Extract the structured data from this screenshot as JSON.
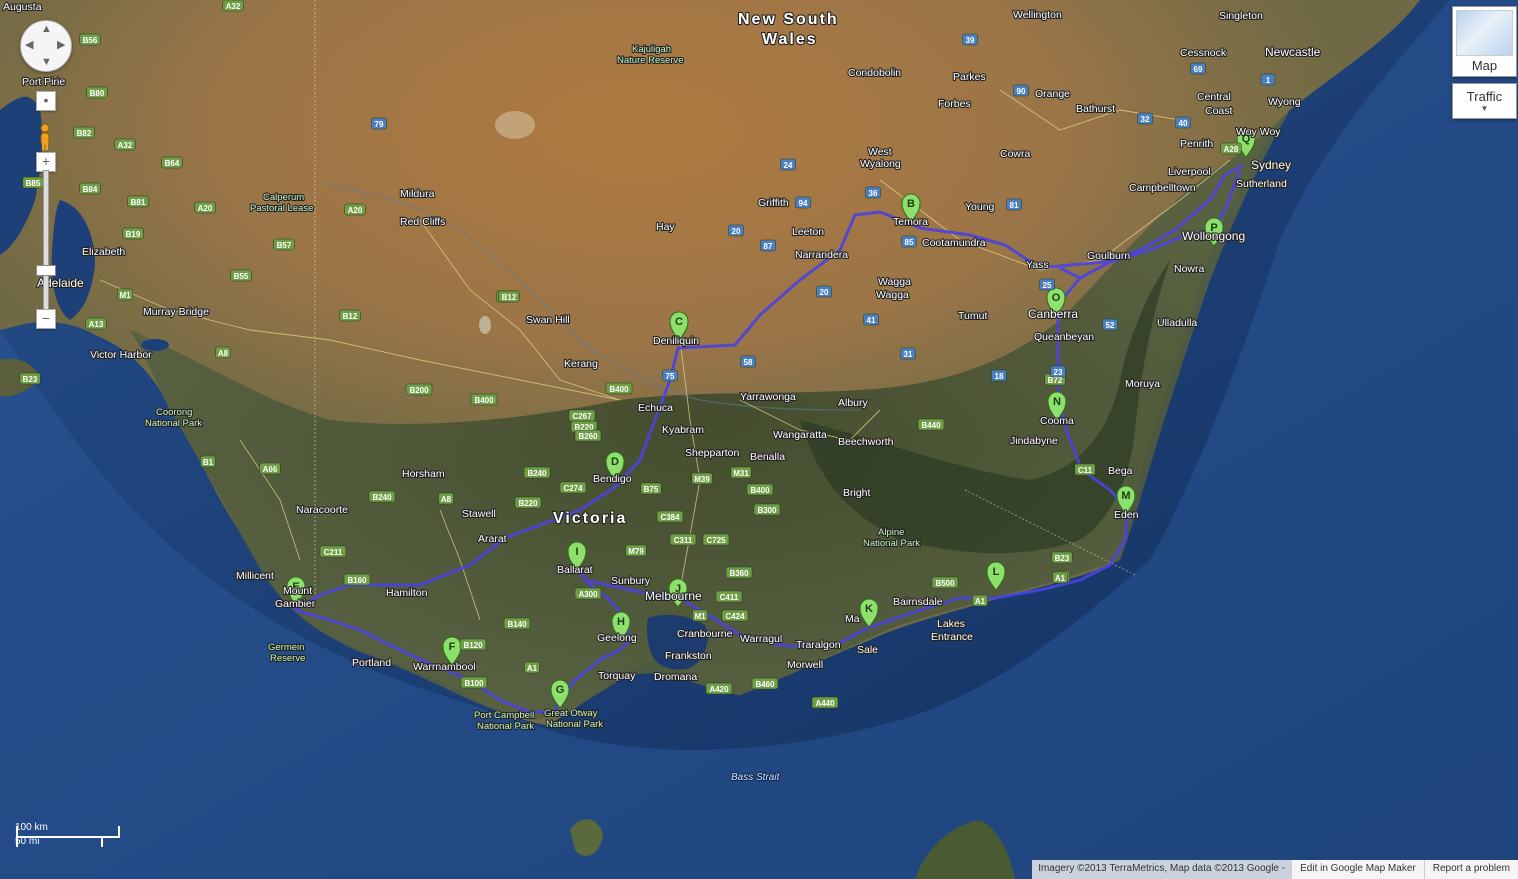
{
  "map_type": {
    "map_label": "Map",
    "traffic_label": "Traffic"
  },
  "colors": {
    "route": "#4b43e0",
    "marker": "#8edf6c",
    "marker_stroke": "#2f6e1e"
  },
  "regions": {
    "nsw": "New South Wales",
    "vic": "Victoria"
  },
  "route_markers": [
    "B",
    "C",
    "D",
    "E",
    "F",
    "G",
    "H",
    "I",
    "J",
    "K",
    "L",
    "M",
    "N",
    "O",
    "P",
    "Q"
  ],
  "places": {
    "augusta": "Augusta",
    "port_pirie": "Port Pirie",
    "adelaide": "Adelaide",
    "elizabeth": "Elizabeth",
    "murray_bridge": "Murray Bridge",
    "victor_harbor": "Victor Harbor",
    "mildura": "Mildura",
    "red_cliffs": "Red Cliffs",
    "swan_hill": "Swan Hill",
    "kerang": "Kerang",
    "echuca": "Echuca",
    "kyabram": "Kyabram",
    "shepparton": "Shepparton",
    "benalla": "Benalla",
    "wangaratta": "Wangaratta",
    "beechworth": "Beechworth",
    "albury": "Albury",
    "yarrawonga": "Yarrawonga",
    "deniliquin": "Deniliquin",
    "hay": "Hay",
    "griffith": "Griffith",
    "leeton": "Leeton",
    "narrandera": "Narrandera",
    "wagga1": "Wagga",
    "wagga2": "Wagga",
    "temora": "Temora",
    "cootamundra": "Cootamundra",
    "young": "Young",
    "west_wyalong1": "West",
    "west_wyalong2": "Wyalong",
    "condobolin": "Condobolin",
    "parkes": "Parkes",
    "forbes": "Forbes",
    "orange": "Orange",
    "bathurst": "Bathurst",
    "cowra": "Cowra",
    "wellington": "Wellington",
    "singleton": "Singleton",
    "cessnock": "Cessnock",
    "newcastle": "Newcastle",
    "wyong": "Wyong",
    "central_coast1": "Central",
    "central_coast2": "Coast",
    "woy_woy": "Woy Woy",
    "penrith": "Penrith",
    "liverpool": "Liverpool",
    "campbelltown": "Campbelltown",
    "sydney": "Sydney",
    "sutherland": "Sutherland",
    "wollongong": "Wollongong",
    "nowra": "Nowra",
    "goulburn": "Goulburn",
    "yass": "Yass",
    "canberra": "Canberra",
    "queanbeyan": "Queanbeyan",
    "tumut": "Tumut",
    "ulladulla": "Ulladulla",
    "moruya": "Moruya",
    "cooma": "Cooma",
    "jindabyne": "Jindabyne",
    "bega": "Bega",
    "eden": "Eden",
    "bendigo": "Bendigo",
    "horsham": "Horsham",
    "stawell": "Stawell",
    "ararat": "Ararat",
    "ballarat": "Ballarat",
    "sunbury": "Sunbury",
    "melbourne": "Melbourne",
    "geelong": "Geelong",
    "torquay": "Torquay",
    "frankston": "Frankston",
    "cranbourne": "Cranbourne",
    "dromana": "Dromana",
    "warragul": "Warragul",
    "traralgon": "Traralgon",
    "morwell": "Morwell",
    "sale": "Sale",
    "maffra": "Ma",
    "bairnsdale": "Bairnsdale",
    "lakes_entrance1": "Lakes",
    "lakes_entrance2": "Entrance",
    "bright": "Bright",
    "hamilton": "Hamilton",
    "portland": "Portland",
    "warrnambool": "Warrnambool",
    "mount_gambier1": "Mount",
    "mount_gambier2": "Gambier",
    "millicent": "Millicent",
    "naracoorte": "Naracoorte",
    "vic_park_label": "Victoria"
  },
  "parks": {
    "kajuligah1": "Kajuligah",
    "kajuligah2": "Nature Reserve",
    "calperum1": "Calperum",
    "calperum2": "Pastoral Lease",
    "coorong1": "Coorong",
    "coorong2": "National Park",
    "alpine1": "Alpine",
    "alpine2": "National Park",
    "germein1": "Germein",
    "germein2": "Reserve",
    "port_campbell1": "Port Campbell",
    "port_campbell2": "National Park",
    "otway1": "Great Otway",
    "otway2": "National Park"
  },
  "water": {
    "bass_strait": "Bass Strait"
  },
  "shields": [
    "A32",
    "B56",
    "B80",
    "B82",
    "A32",
    "B64",
    "B85",
    "B84",
    "B81",
    "A20",
    "B19",
    "A20",
    "B57",
    "B55",
    "M1",
    "A13",
    "B23",
    "B12",
    "A8",
    "B1",
    "A66",
    "B12",
    "B240",
    "A8",
    "C211",
    "B160",
    "B200",
    "B400",
    "B220",
    "B260",
    "C267",
    "B240",
    "B220",
    "C274",
    "B75",
    "M39",
    "M31",
    "C384",
    "B300",
    "C311",
    "C725",
    "M79",
    "B360",
    "A300",
    "C411",
    "C424",
    "M1",
    "B140",
    "B120",
    "A1",
    "B100",
    "A440",
    "B460",
    "A420",
    "B440",
    "B500",
    "A1",
    "B23",
    "A1",
    "B400",
    "B72",
    "C11",
    "79",
    "24",
    "87",
    "94",
    "36",
    "85",
    "81",
    "90",
    "39",
    "69",
    "32",
    "40",
    "1",
    "A28",
    "25",
    "23",
    "A1",
    "58",
    "75",
    "41",
    "20",
    "31",
    "52",
    "18",
    "20",
    "B12",
    "B400"
  ],
  "footer": {
    "attribution": "Imagery ©2013 TerraMetrics, Map data ©2013 Google -",
    "edit_link": "Edit in Google Map Maker",
    "report_link": "Report a problem"
  },
  "scale": {
    "km": "100 km",
    "mi": "50 mi"
  }
}
